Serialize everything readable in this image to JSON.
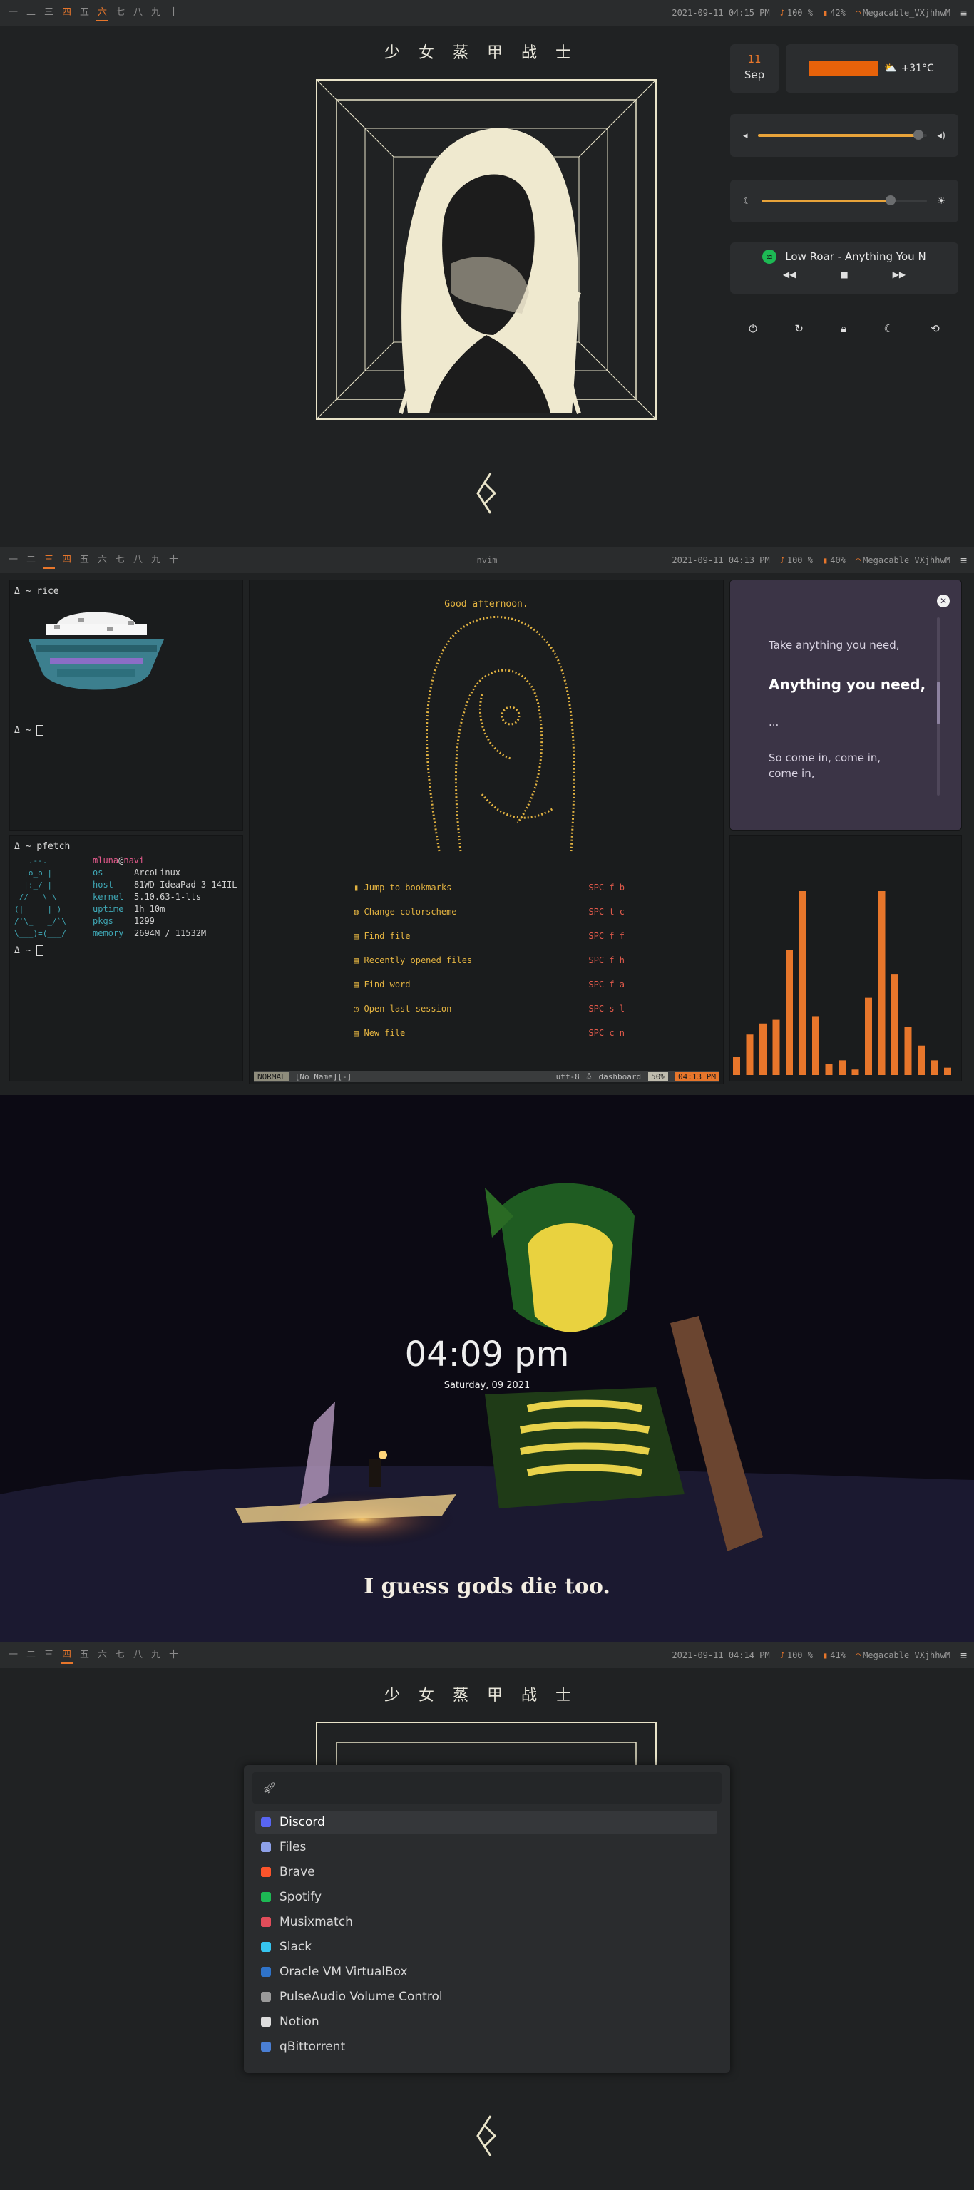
{
  "bars": [
    {
      "workspaces": [
        "一",
        "二",
        "三",
        "四",
        "五",
        "六",
        "七",
        "八",
        "九",
        "十"
      ],
      "active": 5,
      "occupied": [
        3
      ],
      "title": "",
      "datetime": "2021-09-11 04:15 PM",
      "volume": "100 %",
      "battery": "42%",
      "wifi": "Megacable_VXjhhwM"
    },
    {
      "workspaces": [
        "一",
        "二",
        "三",
        "四",
        "五",
        "六",
        "七",
        "八",
        "九",
        "十"
      ],
      "active": 2,
      "occupied": [
        3
      ],
      "title": "nvim",
      "datetime": "2021-09-11 04:13 PM",
      "volume": "100 %",
      "battery": "40%",
      "wifi": "Megacable_VXjhhwM"
    },
    {
      "workspaces": [
        "一",
        "二",
        "三",
        "四",
        "五",
        "六",
        "七",
        "八",
        "九",
        "十"
      ],
      "active": 3,
      "occupied": [
        3
      ],
      "title": "",
      "datetime": "2021-09-11 04:14 PM",
      "volume": "100 %",
      "battery": "41%",
      "wifi": "Megacable_VXjhhwM"
    }
  ],
  "screen1": {
    "title_cn": "少女蒸甲战士",
    "date": {
      "day": "11",
      "month": "Sep"
    },
    "weather": {
      "temp": "+31°C",
      "icon": "⛅"
    },
    "volume_level": 0.95,
    "brightness_level": 0.78,
    "music": {
      "title": "Low Roar - Anything You N"
    },
    "power_icons": [
      "power-icon",
      "reboot-icon",
      "lock-icon",
      "sleep-icon",
      "logout-icon"
    ]
  },
  "screen2": {
    "rice_prompt": "Δ ~ rice",
    "empty_prompt": "Δ ~",
    "pfetch_prompt": "Δ ~ pfetch",
    "pfetch": {
      "user": "mluna",
      "at": "@",
      "host": "navi",
      "rows": [
        {
          "key": "os",
          "val": "ArcoLinux"
        },
        {
          "key": "host",
          "val": "81WD IdeaPad 3 14IIL"
        },
        {
          "key": "kernel",
          "val": "5.10.63-1-lts"
        },
        {
          "key": "uptime",
          "val": "1h 10m"
        },
        {
          "key": "pkgs",
          "val": "1299"
        },
        {
          "key": "memory",
          "val": "2694M / 11532M"
        }
      ]
    },
    "nvim": {
      "greeting": "Good afternoon.",
      "menu": [
        {
          "icon": "bookmark-icon",
          "label": "Jump to bookmarks",
          "key": "SPC f b"
        },
        {
          "icon": "palette-icon",
          "label": "Change colorscheme",
          "key": "SPC t c"
        },
        {
          "icon": "file-icon",
          "label": "Find file",
          "key": "SPC f f"
        },
        {
          "icon": "file-icon",
          "label": "Recently opened files",
          "key": "SPC f h"
        },
        {
          "icon": "file-icon",
          "label": "Find word",
          "key": "SPC f a"
        },
        {
          "icon": "session-icon",
          "label": "Open last session",
          "key": "SPC s l"
        },
        {
          "icon": "file-icon",
          "label": "New file",
          "key": "SPC c n"
        }
      ],
      "status": {
        "mode": "NORMAL",
        "file": "[No Name][-]",
        "enc": "utf-8",
        "ft": "dashboard",
        "pct": "50%",
        "time": "04:13 PM"
      }
    },
    "lyrics": [
      "Take anything you need,",
      "Anything you need,",
      "...",
      "So come in, come in,",
      "come in,"
    ],
    "visualizer": [
      0.1,
      0.22,
      0.28,
      0.3,
      0.68,
      1.0,
      0.32,
      0.06,
      0.08,
      0.03,
      0.42,
      1.0,
      0.55,
      0.26,
      0.16,
      0.08,
      0.04
    ]
  },
  "screen3": {
    "time": "04:09 pm",
    "date": "Saturday, 09 2021",
    "quote": "I guess gods die too."
  },
  "screen4": {
    "title_cn": "少女蒸甲战士",
    "search_placeholder": "",
    "apps": [
      {
        "name": "Discord",
        "color": "#5865f2"
      },
      {
        "name": "Files",
        "color": "#8da0e8"
      },
      {
        "name": "Brave",
        "color": "#fb542b"
      },
      {
        "name": "Spotify",
        "color": "#1db954"
      },
      {
        "name": "Musixmatch",
        "color": "#e24d5a"
      },
      {
        "name": "Slack",
        "color": "#36c5f0"
      },
      {
        "name": "Oracle VM VirtualBox",
        "color": "#2f73c9"
      },
      {
        "name": "PulseAudio Volume Control",
        "color": "#9a9a9a"
      },
      {
        "name": "Notion",
        "color": "#dddddd"
      },
      {
        "name": "qBittorrent",
        "color": "#4a7fd4"
      }
    ]
  }
}
